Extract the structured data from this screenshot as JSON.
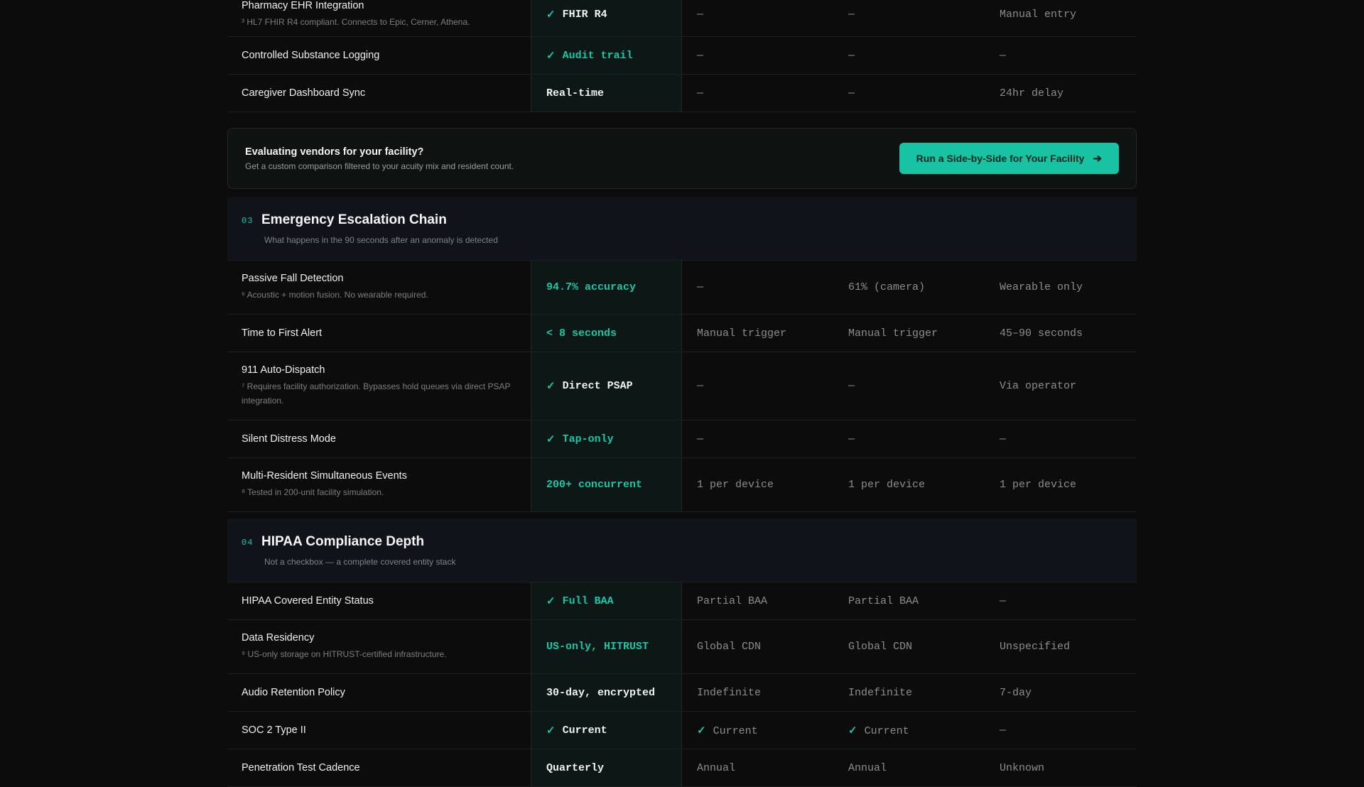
{
  "rows_top": [
    {
      "name": "Pharmacy EHR Integration",
      "note": "³ HL7 FHIR R4 compliant. Connects to Epic, Cerner, Athena.",
      "ours": {
        "check": true,
        "text": "FHIR R4",
        "teal": false
      },
      "c2": "—",
      "c3": "—",
      "c4": "Manual entry"
    },
    {
      "name": "Controlled Substance Logging",
      "note": "",
      "ours": {
        "check": true,
        "text": "Audit trail",
        "teal": true
      },
      "c2": "—",
      "c3": "—",
      "c4": "—"
    },
    {
      "name": "Caregiver Dashboard Sync",
      "note": "",
      "ours": {
        "check": false,
        "text": "Real-time",
        "teal": false
      },
      "c2": "—",
      "c3": "—",
      "c4": "24hr delay"
    }
  ],
  "cta": {
    "title": "Evaluating vendors for your facility?",
    "subtitle": "Get a custom comparison filtered to your acuity mix and resident count.",
    "button_label": "Run a Side-by-Side for Your Facility",
    "button_icon": "arrow-right-icon"
  },
  "section3": {
    "number": "03",
    "title": "Emergency Escalation Chain",
    "subtitle": "What happens in the 90 seconds after an anomaly is detected",
    "rows": [
      {
        "name": "Passive Fall Detection",
        "note": "⁶ Acoustic + motion fusion. No wearable required.",
        "ours": {
          "check": false,
          "text": "94.7% accuracy",
          "teal": true
        },
        "c2": "—",
        "c3": "61% (camera)",
        "c4": "Wearable only"
      },
      {
        "name": "Time to First Alert",
        "note": "",
        "ours": {
          "check": false,
          "text": "< 8 seconds",
          "teal": true
        },
        "c2": "Manual trigger",
        "c3": "Manual trigger",
        "c4": "45–90 seconds"
      },
      {
        "name": "911 Auto-Dispatch",
        "note": "⁷ Requires facility authorization. Bypasses hold queues via direct PSAP integration.",
        "ours": {
          "check": true,
          "text": "Direct PSAP",
          "teal": false
        },
        "c2": "—",
        "c3": "—",
        "c4": "Via operator"
      },
      {
        "name": "Silent Distress Mode",
        "note": "",
        "ours": {
          "check": true,
          "text": "Tap-only",
          "teal": true
        },
        "c2": "—",
        "c3": "—",
        "c4": "—"
      },
      {
        "name": "Multi-Resident Simultaneous Events",
        "note": "⁸ Tested in 200-unit facility simulation.",
        "ours": {
          "check": false,
          "text": "200+ concurrent",
          "teal": true
        },
        "c2": "1 per device",
        "c3": "1 per device",
        "c4": "1 per device"
      }
    ]
  },
  "section4": {
    "number": "04",
    "title": "HIPAA Compliance Depth",
    "subtitle": "Not a checkbox — a complete covered entity stack",
    "rows": [
      {
        "name": "HIPAA Covered Entity Status",
        "note": "",
        "ours": {
          "check": true,
          "text": "Full BAA",
          "teal": true
        },
        "c2": "Partial BAA",
        "c3": "Partial BAA",
        "c4": "—"
      },
      {
        "name": "Data Residency",
        "note": "⁹ US-only storage on HITRUST-certified infrastructure.",
        "ours": {
          "check": false,
          "text": "US-only, HITRUST",
          "teal": true
        },
        "c2": "Global CDN",
        "c3": "Global CDN",
        "c4": "Unspecified"
      },
      {
        "name": "Audio Retention Policy",
        "note": "",
        "ours": {
          "check": false,
          "text": "30-day, encrypted",
          "teal": false
        },
        "c2": "Indefinite",
        "c3": "Indefinite",
        "c4": "7-day"
      },
      {
        "name": "SOC 2 Type II",
        "note": "",
        "ours": {
          "check": true,
          "text": "Current",
          "teal": false
        },
        "c2": "✓ Current",
        "c3": "✓ Current",
        "c4": "—"
      },
      {
        "name": "Penetration Test Cadence",
        "note": "",
        "ours": {
          "check": false,
          "text": "Quarterly",
          "teal": false
        },
        "c2": "Annual",
        "c3": "Annual",
        "c4": "Unknown"
      }
    ]
  },
  "colors": {
    "accent": "#19c6a8",
    "background": "#0c0c0d",
    "section_background": "#11131a"
  }
}
